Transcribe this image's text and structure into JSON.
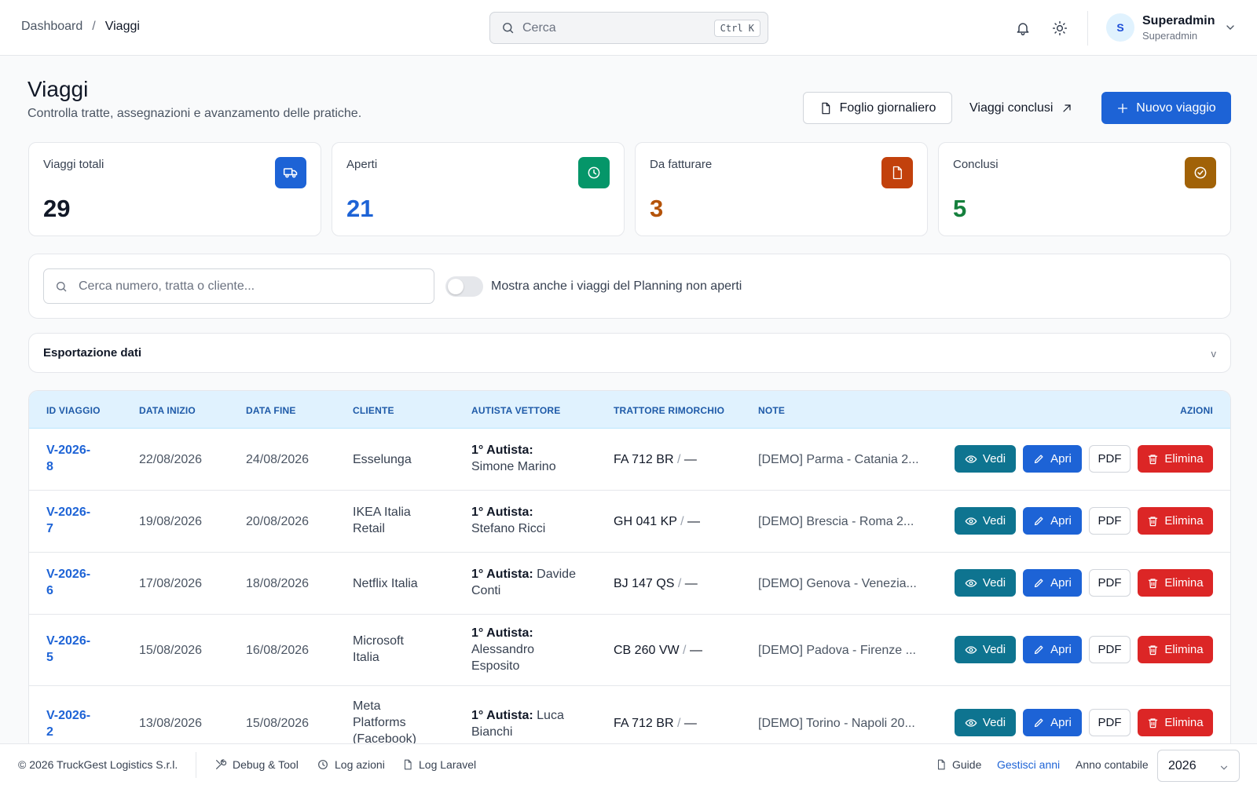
{
  "breadcrumb": {
    "root": "Dashboard",
    "separator": "/",
    "current": "Viaggi"
  },
  "global_search": {
    "placeholder": "Cerca",
    "shortcut": "Ctrl K"
  },
  "user": {
    "initial": "S",
    "name": "Superadmin",
    "role": "Superadmin"
  },
  "page": {
    "title": "Viaggi",
    "subtitle": "Controlla tratte, assegnazioni e avanzamento delle pratiche."
  },
  "header_actions": {
    "daily_sheet": "Foglio giornaliero",
    "closed_trips": "Viaggi conclusi",
    "new_trip": "Nuovo viaggio"
  },
  "stats": [
    {
      "label": "Viaggi totali",
      "value": "29",
      "icon": "truck-icon",
      "icon_bg": "#1d63d6",
      "value_color": "#111827"
    },
    {
      "label": "Aperti",
      "value": "21",
      "icon": "clock-icon",
      "icon_bg": "#059669",
      "value_color": "#1d63d6"
    },
    {
      "label": "Da fatturare",
      "value": "3",
      "icon": "document-icon",
      "icon_bg": "#c2410c",
      "value_color": "#b45309"
    },
    {
      "label": "Conclusi",
      "value": "5",
      "icon": "check-circle-icon",
      "icon_bg": "#a16207",
      "value_color": "#15803d"
    }
  ],
  "filters": {
    "search_placeholder": "Cerca numero, tratta o cliente...",
    "toggle_label": "Mostra anche i viaggi del Planning non aperti",
    "toggle_on": false
  },
  "export": {
    "title": "Esportazione dati",
    "chevron": "v"
  },
  "table": {
    "headers": {
      "id": "ID VIAGGIO",
      "start": "DATA INIZIO",
      "end": "DATA FINE",
      "client": "CLIENTE",
      "driver": "AUTISTA VETTORE",
      "vehicle": "TRATTORE RIMORCHIO",
      "notes": "NOTE",
      "actions": "AZIONI"
    },
    "action_labels": {
      "view": "Vedi",
      "open": "Apri",
      "pdf": "PDF",
      "delete": "Elimina"
    },
    "driver_prefix": "1° Autista:",
    "rows": [
      {
        "id_a": "V-2026-",
        "id_b": "8",
        "start": "22/08/2026",
        "end": "24/08/2026",
        "client": "Esselunga",
        "driver": "Simone Marino",
        "tractor": "FA 712 BR",
        "trailer": "—",
        "notes": "[DEMO] Parma - Catania 2..."
      },
      {
        "id_a": "V-2026-",
        "id_b": "7",
        "start": "19/08/2026",
        "end": "20/08/2026",
        "client": "IKEA Italia Retail",
        "driver": "Stefano Ricci",
        "tractor": "GH 041 KP",
        "trailer": "—",
        "notes": "[DEMO] Brescia - Roma 2..."
      },
      {
        "id_a": "V-2026-",
        "id_b": "6",
        "start": "17/08/2026",
        "end": "18/08/2026",
        "client": "Netflix Italia",
        "driver": "Davide Conti",
        "tractor": "BJ 147 QS",
        "trailer": "—",
        "notes": "[DEMO] Genova - Venezia..."
      },
      {
        "id_a": "V-2026-",
        "id_b": "5",
        "start": "15/08/2026",
        "end": "16/08/2026",
        "client": "Microsoft Italia",
        "driver": "Alessandro Esposito",
        "tractor": "CB 260 VW",
        "trailer": "—",
        "notes": "[DEMO] Padova - Firenze ..."
      },
      {
        "id_a": "V-2026-",
        "id_b": "2",
        "start": "13/08/2026",
        "end": "15/08/2026",
        "client": "Meta Platforms (Facebook)",
        "driver": "Luca Bianchi",
        "tractor": "FA 712 BR",
        "trailer": "—",
        "notes": "[DEMO] Torino - Napoli 20..."
      }
    ]
  },
  "footer": {
    "copyright": "© 2026 TruckGest Logistics S.r.l.",
    "debug": "Debug & Tool",
    "log_actions": "Log azioni",
    "log_laravel": "Log Laravel",
    "guide": "Guide",
    "manage_years": "Gestisci anni",
    "fiscal_year_label": "Anno contabile",
    "fiscal_year": "2026"
  }
}
